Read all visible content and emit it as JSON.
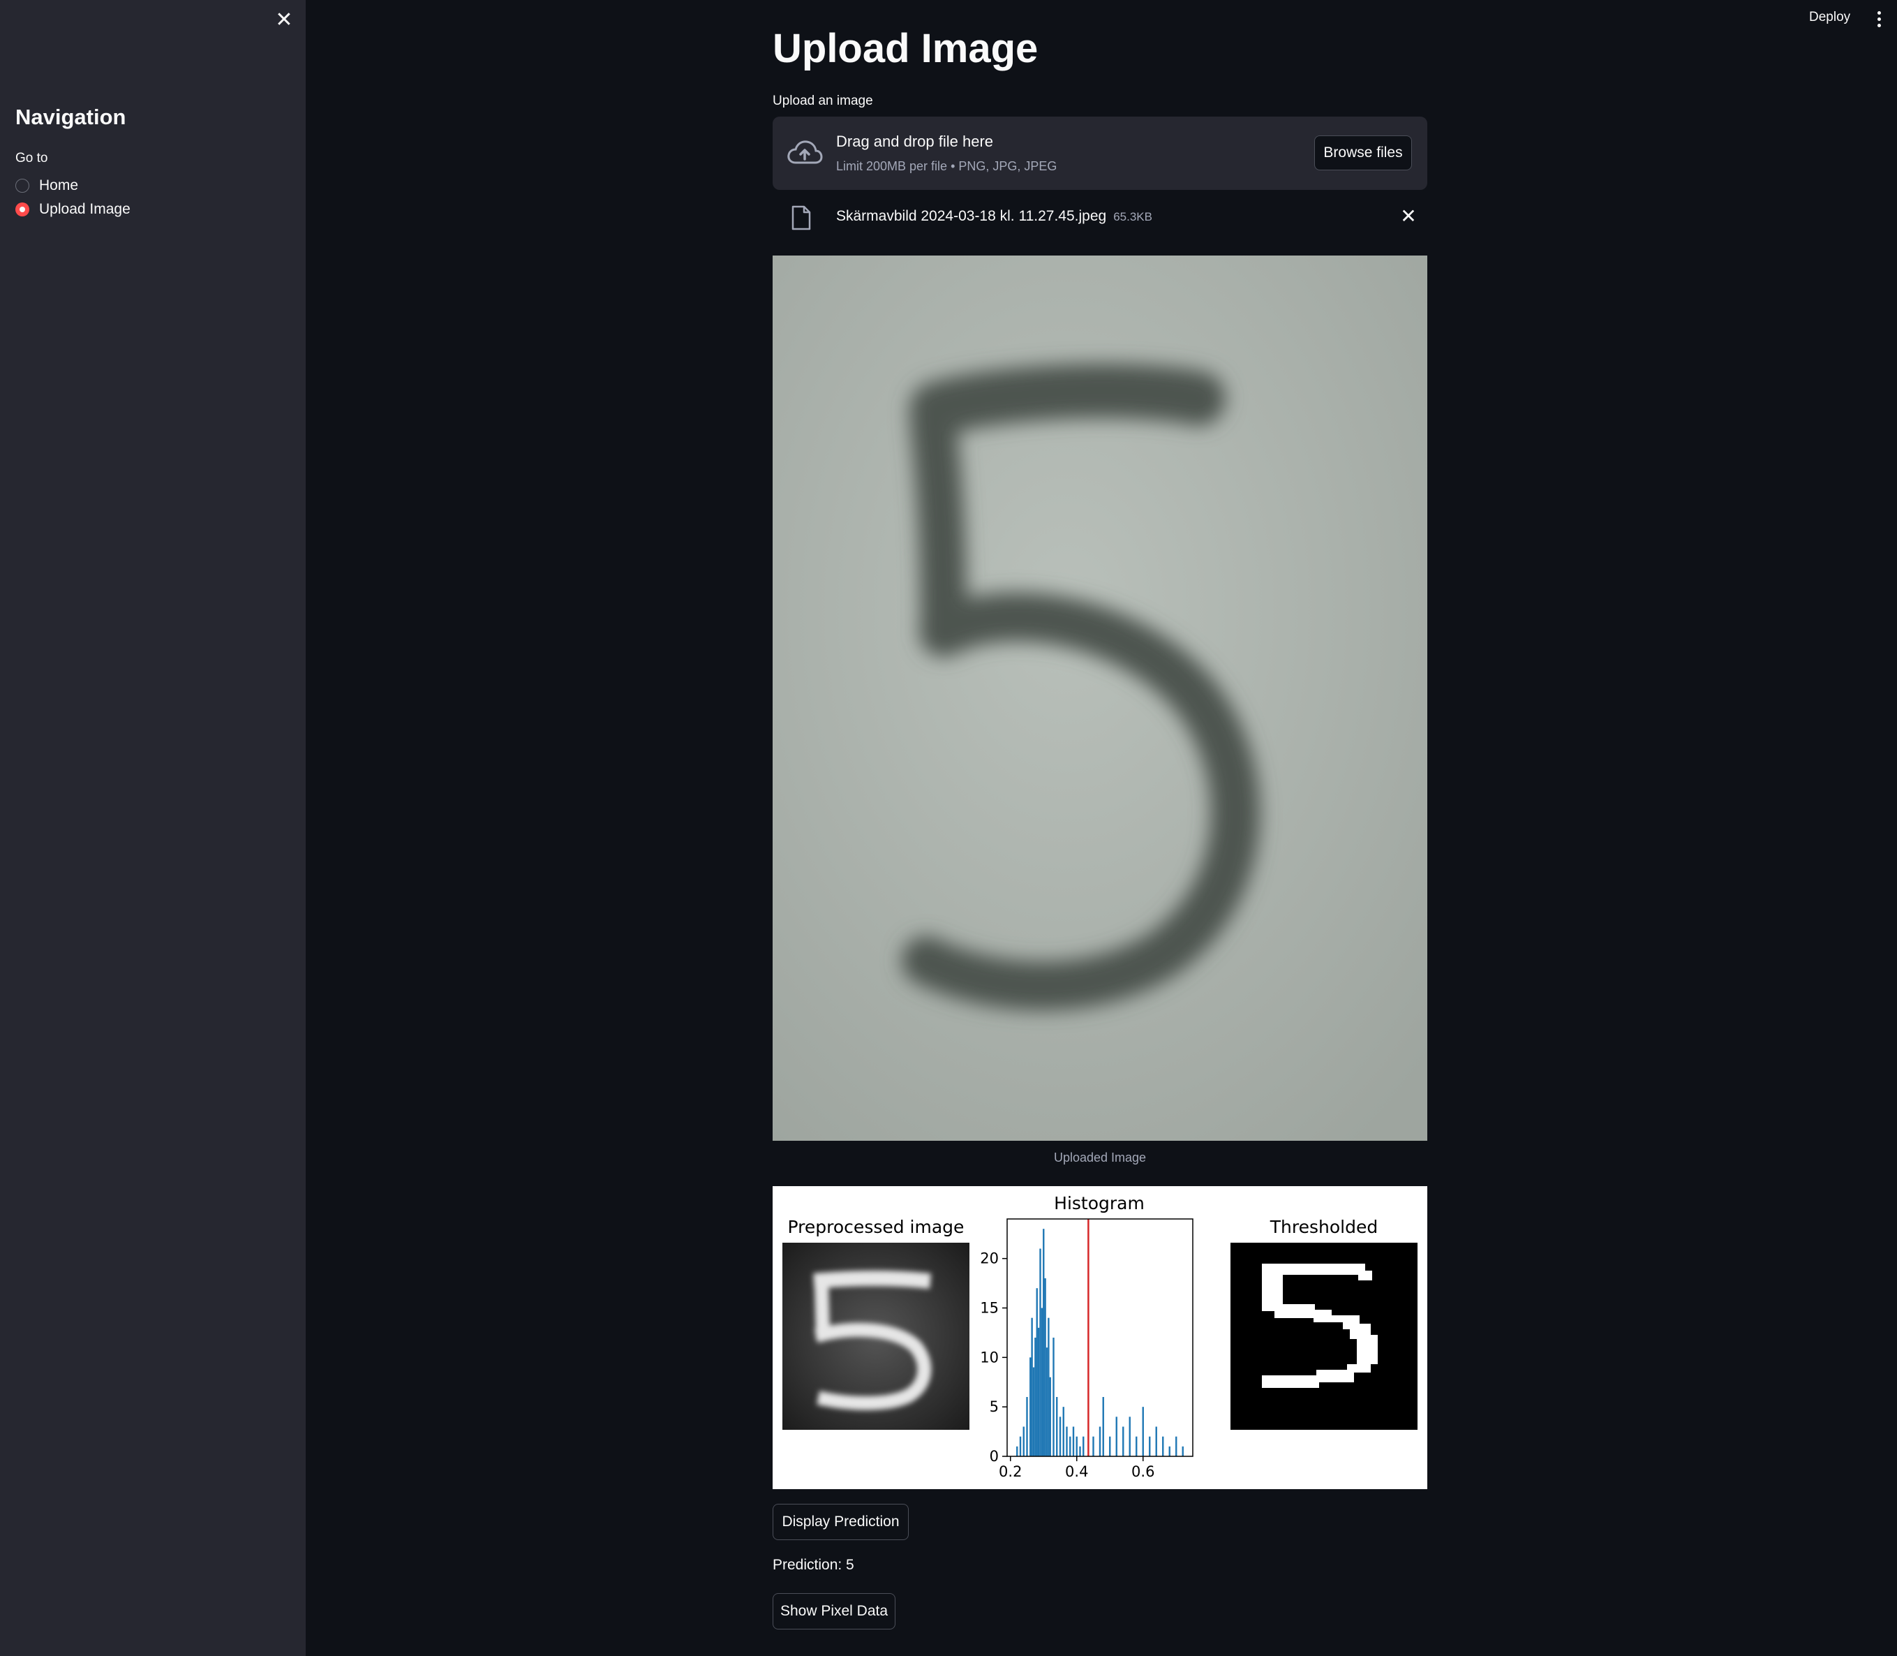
{
  "sidebar": {
    "title": "Navigation",
    "go_to_label": "Go to",
    "options": [
      {
        "label": "Home",
        "selected": false
      },
      {
        "label": "Upload Image",
        "selected": true
      }
    ],
    "close_icon": "close-icon"
  },
  "header": {
    "deploy_label": "Deploy",
    "menu_icon": "more-vertical-icon"
  },
  "main": {
    "title": "Upload Image",
    "uploader": {
      "label": "Upload an image",
      "drop_text": "Drag and drop file here",
      "limit_text": "Limit 200MB per file • PNG, JPG, JPEG",
      "browse_label": "Browse files",
      "icon": "cloud-upload-icon"
    },
    "file": {
      "name": "Skärmavbild 2024-03-18 kl. 11.27.45.jpeg",
      "size": "65.3KB",
      "icon": "file-icon",
      "remove_icon": "close-icon"
    },
    "image_caption": "Uploaded Image",
    "figure": {
      "preprocessed_title": "Preprocessed image",
      "histogram_title": "Histogram",
      "thresholded_title": "Thresholded"
    },
    "display_prediction_label": "Display Prediction",
    "prediction_text": "Prediction: 5",
    "show_pixel_label": "Show Pixel Data"
  },
  "chart_data": {
    "type": "bar",
    "title": "Histogram",
    "xlabel": "",
    "ylabel": "",
    "xlim": [
      0.19,
      0.75
    ],
    "ylim": [
      0,
      24
    ],
    "xticks": [
      "0.2",
      "0.4",
      "0.6"
    ],
    "xtick_values": [
      0.2,
      0.4,
      0.6
    ],
    "yticks": [
      "0",
      "5",
      "10",
      "15",
      "20"
    ],
    "ytick_values": [
      0,
      5,
      10,
      15,
      20
    ],
    "threshold_line": 0.435,
    "bar_color": "#1f77b4",
    "threshold_color": "#d62728",
    "bins": [
      [
        0.22,
        1
      ],
      [
        0.23,
        2
      ],
      [
        0.24,
        3
      ],
      [
        0.25,
        6
      ],
      [
        0.26,
        10
      ],
      [
        0.265,
        14
      ],
      [
        0.27,
        9
      ],
      [
        0.275,
        12
      ],
      [
        0.28,
        17
      ],
      [
        0.285,
        13
      ],
      [
        0.29,
        21
      ],
      [
        0.295,
        15
      ],
      [
        0.3,
        23
      ],
      [
        0.305,
        18
      ],
      [
        0.31,
        11
      ],
      [
        0.315,
        14
      ],
      [
        0.32,
        8
      ],
      [
        0.33,
        12
      ],
      [
        0.34,
        6
      ],
      [
        0.35,
        4
      ],
      [
        0.36,
        5
      ],
      [
        0.37,
        3
      ],
      [
        0.38,
        2
      ],
      [
        0.39,
        3
      ],
      [
        0.4,
        2
      ],
      [
        0.41,
        1
      ],
      [
        0.42,
        2
      ],
      [
        0.45,
        2
      ],
      [
        0.47,
        3
      ],
      [
        0.48,
        6
      ],
      [
        0.5,
        2
      ],
      [
        0.52,
        4
      ],
      [
        0.54,
        3
      ],
      [
        0.56,
        4
      ],
      [
        0.58,
        2
      ],
      [
        0.6,
        5
      ],
      [
        0.62,
        2
      ],
      [
        0.64,
        3
      ],
      [
        0.66,
        2
      ],
      [
        0.68,
        1
      ],
      [
        0.7,
        2
      ],
      [
        0.72,
        1
      ]
    ]
  }
}
